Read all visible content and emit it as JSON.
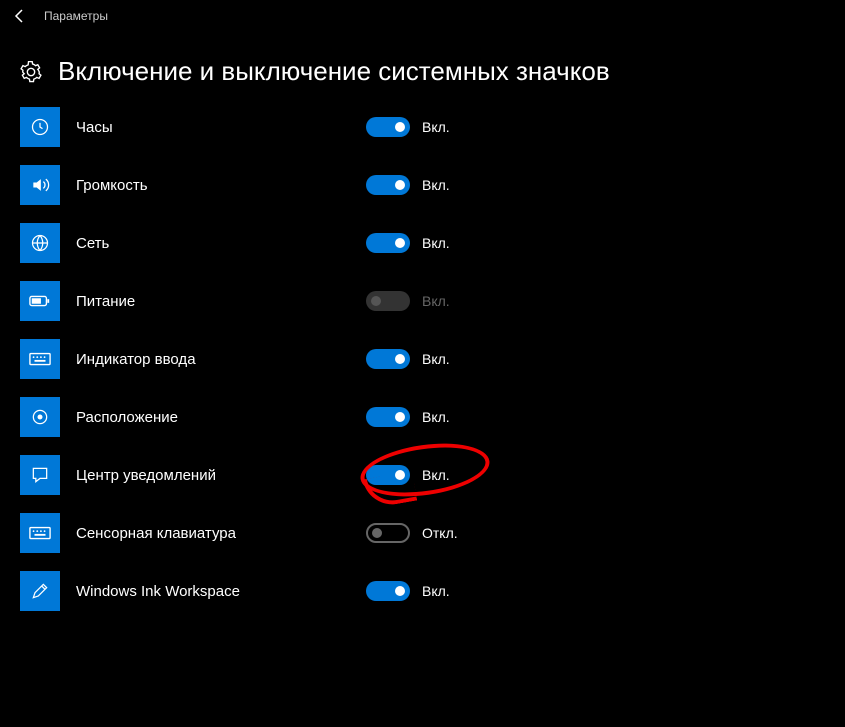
{
  "topbar": {
    "title": "Параметры"
  },
  "page": {
    "title": "Включение и выключение системных значков"
  },
  "labels": {
    "on": "Вкл.",
    "off": "Откл."
  },
  "items": [
    {
      "icon": "clock",
      "label": "Часы",
      "state": "on",
      "disabled": false,
      "annotated": false
    },
    {
      "icon": "volume",
      "label": "Громкость",
      "state": "on",
      "disabled": false,
      "annotated": false
    },
    {
      "icon": "globe",
      "label": "Сеть",
      "state": "on",
      "disabled": false,
      "annotated": false
    },
    {
      "icon": "battery",
      "label": "Питание",
      "state": "on",
      "disabled": true,
      "annotated": false
    },
    {
      "icon": "keyboard",
      "label": "Индикатор ввода",
      "state": "on",
      "disabled": false,
      "annotated": false
    },
    {
      "icon": "location",
      "label": "Расположение",
      "state": "on",
      "disabled": false,
      "annotated": false
    },
    {
      "icon": "notification",
      "label": "Центр уведомлений",
      "state": "on",
      "disabled": false,
      "annotated": true
    },
    {
      "icon": "keyboard",
      "label": "Сенсорная клавиатура",
      "state": "off",
      "disabled": false,
      "annotated": false
    },
    {
      "icon": "pen",
      "label": "Windows Ink Workspace",
      "state": "on",
      "disabled": false,
      "annotated": false
    }
  ]
}
